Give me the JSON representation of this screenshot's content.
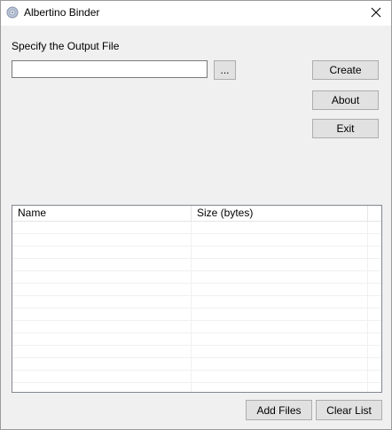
{
  "window": {
    "title": "Albertino Binder",
    "close_glyph": "✕"
  },
  "output": {
    "label": "Specify the Output File",
    "value": "",
    "browse_label": "..."
  },
  "buttons": {
    "create": "Create",
    "about": "About",
    "exit": "Exit",
    "add_files": "Add Files",
    "clear_list": "Clear List"
  },
  "file_list": {
    "columns": [
      "Name",
      "Size (bytes)"
    ],
    "rows": []
  },
  "icons": {
    "app": "app-gear-icon",
    "close": "close-icon"
  },
  "colors": {
    "window_bg": "#f0f0f0",
    "titlebar_bg": "#ffffff",
    "button_bg": "#e1e1e1",
    "button_border": "#adadad"
  }
}
